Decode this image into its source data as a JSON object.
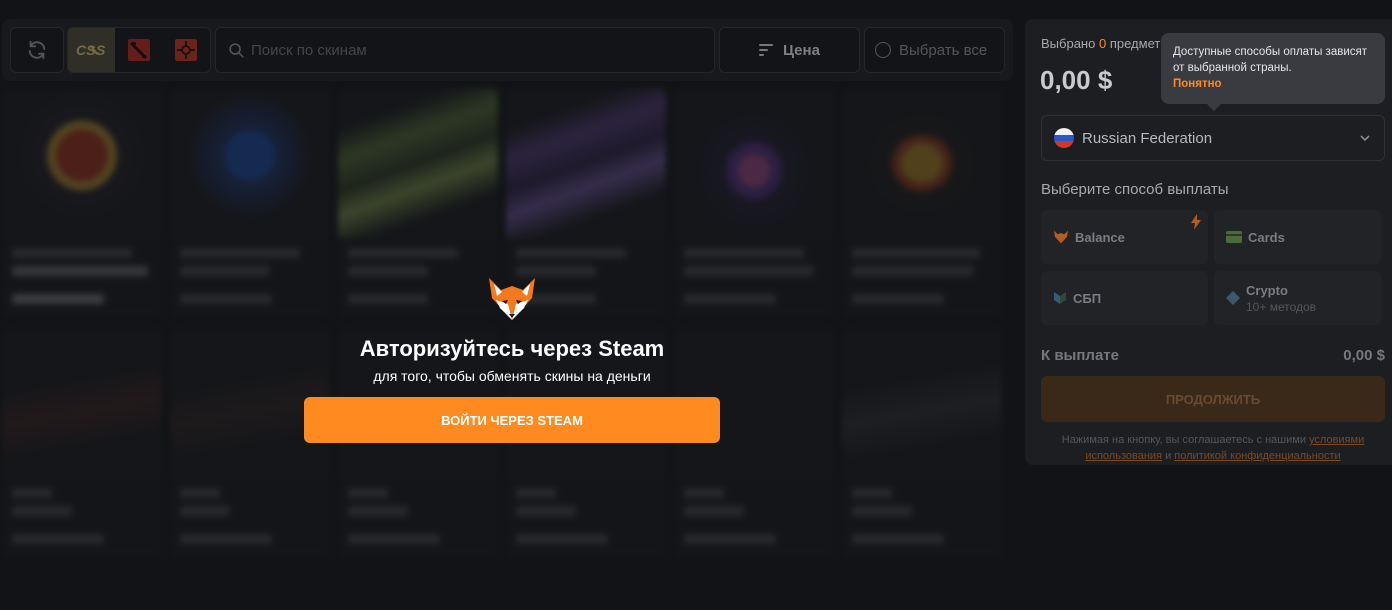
{
  "toolbar": {
    "search_placeholder": "Поиск по скинам",
    "sort_label": "Цена",
    "select_all_label": "Выбрать все",
    "games": [
      "cs2-icon",
      "dota2-icon",
      "rust-icon"
    ]
  },
  "auth": {
    "title": "Авторизуйтесь через Steam",
    "subtitle": "для того, чтобы обменять скины на деньги",
    "button_label": "ВОЙТИ ЧЕРЕЗ STEAM"
  },
  "panel": {
    "selected_label": "Выбрано",
    "selected_count": "0",
    "selected_suffix": "предмет",
    "total": "0,00 $",
    "tooltip_text": "Доступные способы оплаты зависят от выбранной страны.",
    "tooltip_ok": "Понятно",
    "country": "Russian Federation",
    "choose_method": "Выберите способ выплаты",
    "methods": [
      {
        "label": "Balance"
      },
      {
        "label": "Cards"
      },
      {
        "label": "СБП"
      },
      {
        "label": "Crypto",
        "sub": "10+ методов"
      }
    ],
    "to_pay_label": "К выплате",
    "to_pay_value": "0,00 $",
    "continue_label": "ПРОДОЛЖИТЬ",
    "terms_prefix": "Нажимая на кнопку, вы соглашаетесь с нашими",
    "terms_link1": "условиями использования",
    "terms_and": "и",
    "terms_link2": "политикой конфиденциальности"
  },
  "colors": {
    "accent": "#ff8a1f",
    "panel_bg": "#1d1e22",
    "page_bg": "#121316"
  }
}
